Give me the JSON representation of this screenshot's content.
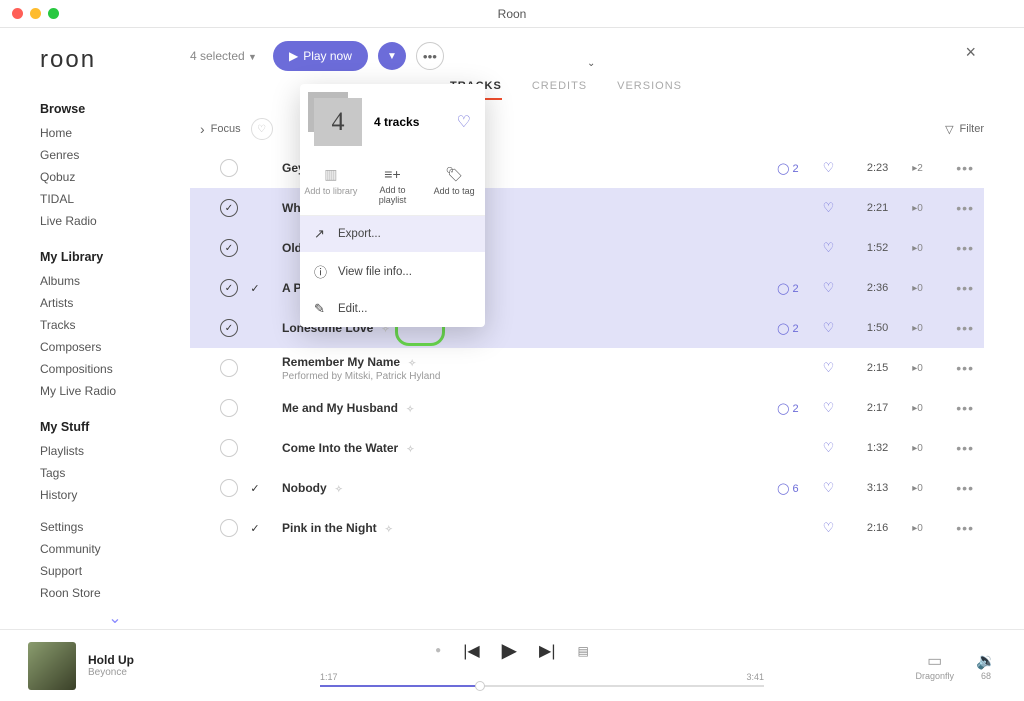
{
  "window": {
    "title": "Roon"
  },
  "app": {
    "logo": "roon"
  },
  "topbar": {
    "selected_label": "4 selected",
    "play_now": "Play now",
    "close": "×"
  },
  "tabs": {
    "tracks": "TRACKS",
    "credits": "CREDITS",
    "versions": "VERSIONS"
  },
  "filterbar": {
    "focus": "Focus",
    "filter": "Filter"
  },
  "sidebar": {
    "browse_title": "Browse",
    "browse": [
      "Home",
      "Genres",
      "Qobuz",
      "TIDAL",
      "Live Radio"
    ],
    "library_title": "My Library",
    "library": [
      "Albums",
      "Artists",
      "Tracks",
      "Composers",
      "Compositions",
      "My Live Radio"
    ],
    "stuff_title": "My Stuff",
    "stuff": [
      "Playlists",
      "Tags",
      "History"
    ],
    "footer": [
      "Settings",
      "Community",
      "Support",
      "Roon Store"
    ]
  },
  "popup": {
    "count_glyph": "4",
    "tracks_label": "4 tracks",
    "add_library": "Add to library",
    "add_playlist": "Add to playlist",
    "add_tag": "Add to tag",
    "export": "Export...",
    "view_file": "View file info...",
    "edit": "Edit..."
  },
  "tracks": [
    {
      "selected": false,
      "pick": false,
      "title": "Gey",
      "plays": "2",
      "heart": true,
      "dur": "2:23",
      "pc": "2",
      "row_sel": false,
      "truncated": true,
      "sub": ""
    },
    {
      "selected": true,
      "pick": false,
      "title": "Wh",
      "plays": "",
      "heart": true,
      "dur": "2:21",
      "pc": "0",
      "row_sel": true,
      "truncated": true,
      "sub": ""
    },
    {
      "selected": true,
      "pick": false,
      "title": "Old",
      "plays": "",
      "heart": true,
      "dur": "1:52",
      "pc": "0",
      "row_sel": true,
      "truncated": true,
      "sub": ""
    },
    {
      "selected": true,
      "pick": true,
      "title": "A Pearl",
      "plays": "2",
      "heart": true,
      "dur": "2:36",
      "pc": "0",
      "row_sel": true,
      "truncated": false,
      "sub": ""
    },
    {
      "selected": true,
      "pick": false,
      "title": "Lonesome Love",
      "plays": "2",
      "heart": true,
      "dur": "1:50",
      "pc": "0",
      "row_sel": true,
      "truncated": false,
      "sub": ""
    },
    {
      "selected": false,
      "pick": false,
      "title": "Remember My Name",
      "plays": "",
      "heart": true,
      "dur": "2:15",
      "pc": "0",
      "row_sel": false,
      "truncated": false,
      "sub": "Performed by Mitski, Patrick Hyland"
    },
    {
      "selected": false,
      "pick": false,
      "title": "Me and My Husband",
      "plays": "2",
      "heart": true,
      "dur": "2:17",
      "pc": "0",
      "row_sel": false,
      "truncated": false,
      "sub": ""
    },
    {
      "selected": false,
      "pick": false,
      "title": "Come Into the Water",
      "plays": "",
      "heart": true,
      "dur": "1:32",
      "pc": "0",
      "row_sel": false,
      "truncated": false,
      "sub": ""
    },
    {
      "selected": false,
      "pick": true,
      "title": "Nobody",
      "plays": "6",
      "heart": true,
      "dur": "3:13",
      "pc": "0",
      "row_sel": false,
      "truncated": false,
      "sub": ""
    },
    {
      "selected": false,
      "pick": true,
      "title": "Pink in the Night",
      "plays": "",
      "heart": true,
      "dur": "2:16",
      "pc": "0",
      "row_sel": false,
      "truncated": false,
      "sub": ""
    }
  ],
  "player": {
    "title": "Hold Up",
    "artist": "Beyonce",
    "elapsed": "1:17",
    "total": "3:41",
    "zone": "Dragonfly",
    "volume": "68"
  }
}
